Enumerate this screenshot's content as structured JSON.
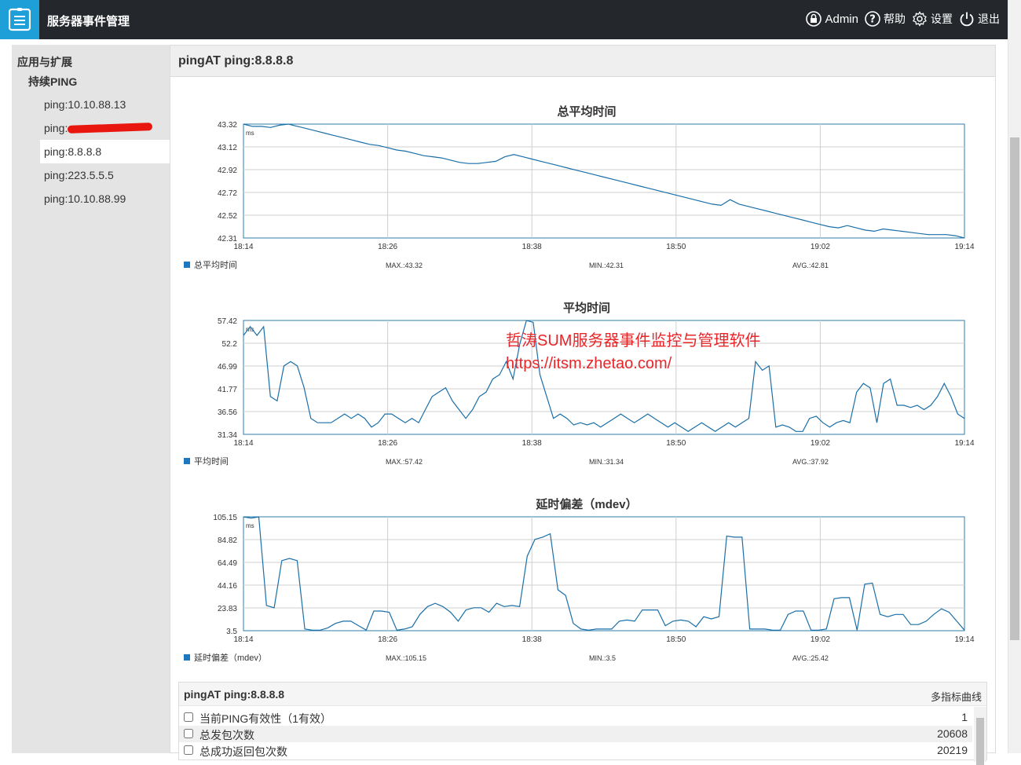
{
  "app": {
    "title": "服务器事件管理"
  },
  "topnav": {
    "admin": "Admin",
    "help": "帮助",
    "settings": "设置",
    "logout": "退出"
  },
  "sidebar": {
    "group": "应用与扩展",
    "subgroup": "持续PING",
    "items": [
      {
        "label": "ping:10.10.88.13"
      },
      {
        "label": "ping:"
      },
      {
        "label": "ping:8.8.8.8"
      },
      {
        "label": "ping:223.5.5.5"
      },
      {
        "label": "ping:10.10.88.99"
      }
    ]
  },
  "main": {
    "title": "pingAT ping:8.8.8.8"
  },
  "watermark": {
    "line1": "哲涛SUM服务器事件监控与管理软件",
    "line2": "https://itsm.zhetao.com/"
  },
  "chart_data": [
    {
      "type": "line",
      "title": "总平均时间",
      "unit": "ms",
      "x_ticks": [
        "18:14",
        "18:26",
        "18:38",
        "18:50",
        "19:02",
        "19:14"
      ],
      "y_ticks": [
        "43.32",
        "43.12",
        "42.92",
        "42.72",
        "42.52",
        "42.31"
      ],
      "ylim": [
        42.31,
        43.32
      ],
      "legend": "总平均时间",
      "color": "#1a6fa8",
      "stats": {
        "max": "MAX.:43.32",
        "min": "MIN.:42.31",
        "avg": "AVG.:42.81"
      },
      "series": [
        {
          "name": "总平均时间",
          "values": [
            43.32,
            43.3,
            43.3,
            43.29,
            43.31,
            43.32,
            43.3,
            43.28,
            43.26,
            43.24,
            43.22,
            43.2,
            43.18,
            43.16,
            43.14,
            43.13,
            43.11,
            43.09,
            43.08,
            43.06,
            43.04,
            43.03,
            43.02,
            43.0,
            42.98,
            42.97,
            42.97,
            42.98,
            42.99,
            43.03,
            43.05,
            43.03,
            43.01,
            42.99,
            42.97,
            42.95,
            42.93,
            42.91,
            42.89,
            42.87,
            42.85,
            42.83,
            42.81,
            42.79,
            42.77,
            42.75,
            42.73,
            42.71,
            42.69,
            42.67,
            42.65,
            42.63,
            42.61,
            42.6,
            42.65,
            42.61,
            42.59,
            42.57,
            42.55,
            42.53,
            42.51,
            42.49,
            42.47,
            42.45,
            42.43,
            42.41,
            42.4,
            42.42,
            42.4,
            42.38,
            42.37,
            42.39,
            42.38,
            42.37,
            42.36,
            42.35,
            42.34,
            42.34,
            42.34,
            42.33,
            42.31
          ]
        }
      ]
    },
    {
      "type": "line",
      "title": "平均时间",
      "unit": "ms",
      "x_ticks": [
        "18:14",
        "18:26",
        "18:38",
        "18:50",
        "19:02",
        "19:14"
      ],
      "y_ticks": [
        "57.42",
        "52.2",
        "46.99",
        "41.77",
        "36.56",
        "31.34"
      ],
      "ylim": [
        31.34,
        57.42
      ],
      "legend": "平均时间",
      "color": "#1a6fa8",
      "stats": {
        "max": "MAX.:57.42",
        "min": "MIN.:31.34",
        "avg": "AVG.:37.92"
      },
      "series": [
        {
          "name": "平均时间",
          "values": [
            54,
            56,
            54,
            56,
            40,
            39,
            47,
            48,
            47,
            42,
            35,
            34,
            34,
            34,
            35,
            36,
            35,
            36,
            35,
            33,
            34,
            36,
            36,
            35,
            34,
            35,
            34,
            37,
            40,
            41,
            42,
            39,
            37,
            35,
            37,
            40,
            41,
            44,
            45,
            48,
            44,
            52,
            57.4,
            57,
            45,
            40,
            35,
            36,
            35,
            33.5,
            34,
            33.5,
            34,
            33,
            34,
            35,
            36,
            35,
            34,
            35,
            36,
            35,
            34,
            33,
            34,
            33,
            32,
            33,
            34,
            33,
            32,
            33,
            34,
            33,
            34,
            35,
            48,
            46,
            47,
            33,
            33.5,
            33,
            32,
            32,
            35,
            35.5,
            34,
            33,
            34,
            34.5,
            34,
            41,
            43,
            42,
            34,
            43,
            44,
            38,
            38,
            37.5,
            38,
            37,
            38,
            40,
            43,
            40,
            36,
            35
          ]
        }
      ]
    },
    {
      "type": "line",
      "title": "延时偏差（mdev）",
      "unit": "ms",
      "x_ticks": [
        "18:14",
        "18:26",
        "18:38",
        "18:50",
        "19:02",
        "19:14"
      ],
      "y_ticks": [
        "105.15",
        "84.82",
        "64.49",
        "44.16",
        "23.83",
        "3.5"
      ],
      "ylim": [
        3.5,
        105.15
      ],
      "legend": "延时偏差（mdev）",
      "color": "#1a6fa8",
      "stats": {
        "max": "MAX.:105.15",
        "min": "MIN.:3.5",
        "avg": "AVG.:25.42"
      },
      "series": [
        {
          "name": "延时偏差（mdev）",
          "values": [
            105,
            104,
            105,
            26,
            24,
            66,
            68,
            66,
            5,
            4,
            4,
            6,
            10,
            12,
            12,
            8,
            4,
            21,
            21,
            20,
            4,
            5,
            7,
            18,
            25,
            28,
            25,
            20,
            12,
            22,
            24,
            24,
            20,
            28,
            25,
            26,
            25,
            70,
            85,
            87,
            90,
            40,
            35,
            10,
            5,
            4,
            5,
            5,
            5,
            12,
            13,
            12,
            22,
            22,
            22,
            8,
            12,
            13,
            12,
            7,
            16,
            14,
            16,
            88,
            87,
            87,
            5,
            5,
            5,
            4,
            4,
            18,
            21,
            21,
            4,
            4,
            5,
            32,
            33,
            33,
            4,
            45,
            46,
            18,
            16,
            18,
            18,
            9,
            9,
            12,
            18,
            23,
            20,
            12,
            4
          ]
        }
      ]
    }
  ],
  "stats_table": {
    "title": "pingAT ping:8.8.8.8",
    "action": "多指标曲线",
    "rows": [
      {
        "label": "当前PING有效性（1有效）",
        "value": "1"
      },
      {
        "label": "总发包次数",
        "value": "20608"
      },
      {
        "label": "总成功返回包次数",
        "value": "20219"
      }
    ]
  }
}
